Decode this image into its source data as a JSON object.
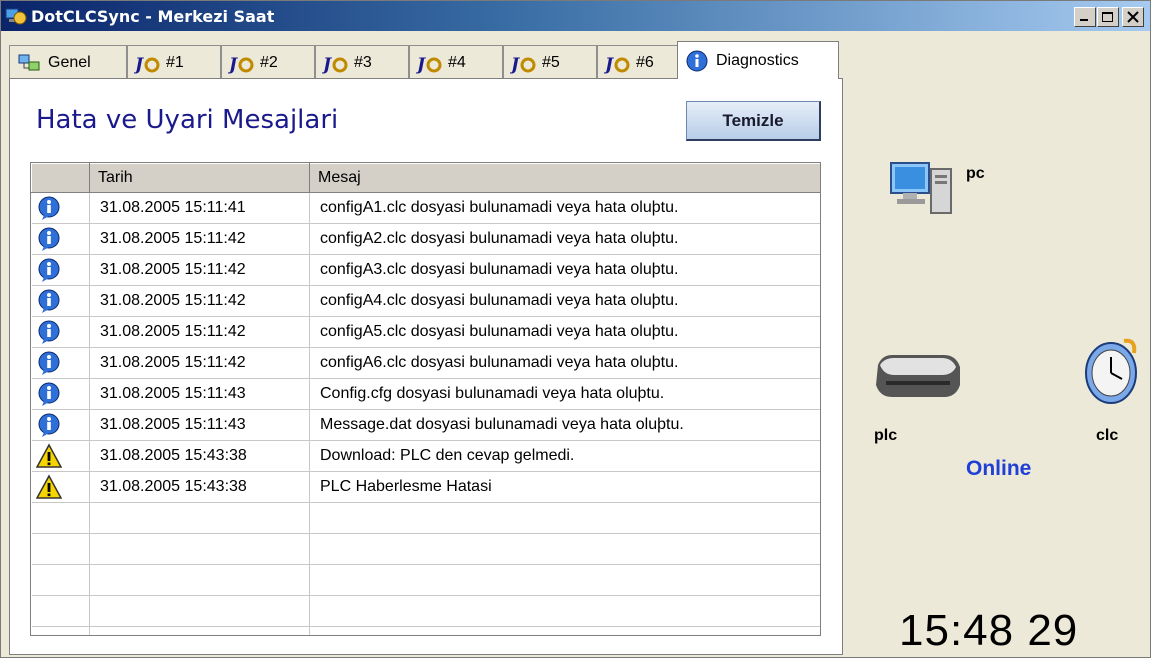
{
  "window": {
    "title": "DotCLCSync - Merkezi Saat"
  },
  "tabs": [
    {
      "label": "Genel",
      "icon": "network-icon"
    },
    {
      "label": "#1",
      "icon": "jo-icon"
    },
    {
      "label": "#2",
      "icon": "jo-icon"
    },
    {
      "label": "#3",
      "icon": "jo-icon"
    },
    {
      "label": "#4",
      "icon": "jo-icon"
    },
    {
      "label": "#5",
      "icon": "jo-icon"
    },
    {
      "label": "#6",
      "icon": "jo-icon"
    },
    {
      "label": "Diagnostics",
      "icon": "info-icon",
      "active": true
    }
  ],
  "panel": {
    "heading": "Hata ve Uyari Mesajlari",
    "clear_button": "Temizle"
  },
  "table": {
    "columns": [
      "",
      "Tarih",
      "Mesaj"
    ],
    "rows": [
      {
        "type": "info",
        "date": "31.08.2005 15:11:41",
        "message": "configA1.clc dosyasi bulunamadi veya hata oluþtu."
      },
      {
        "type": "info",
        "date": "31.08.2005 15:11:42",
        "message": "configA2.clc dosyasi bulunamadi veya hata oluþtu."
      },
      {
        "type": "info",
        "date": "31.08.2005 15:11:42",
        "message": "configA3.clc dosyasi bulunamadi veya hata oluþtu."
      },
      {
        "type": "info",
        "date": "31.08.2005 15:11:42",
        "message": "configA4.clc dosyasi bulunamadi veya hata oluþtu."
      },
      {
        "type": "info",
        "date": "31.08.2005 15:11:42",
        "message": "configA5.clc dosyasi bulunamadi veya hata oluþtu."
      },
      {
        "type": "info",
        "date": "31.08.2005 15:11:42",
        "message": "configA6.clc dosyasi bulunamadi veya hata oluþtu."
      },
      {
        "type": "info",
        "date": "31.08.2005 15:11:43",
        "message": "Config.cfg dosyasi bulunamadi veya hata oluþtu."
      },
      {
        "type": "info",
        "date": "31.08.2005 15:11:43",
        "message": "Message.dat dosyasi bulunamadi veya hata oluþtu."
      },
      {
        "type": "warning",
        "date": "31.08.2005 15:43:38",
        "message": "Download: PLC den cevap gelmedi."
      },
      {
        "type": "warning",
        "date": "31.08.2005 15:43:38",
        "message": "PLC Haberlesme Hatasi"
      }
    ]
  },
  "status": {
    "pc_label": "pc",
    "plc_label": "plc",
    "clc_label": "clc",
    "connection": "Online",
    "connection_color": "#1f3fd6",
    "clock": "15:48 29"
  }
}
